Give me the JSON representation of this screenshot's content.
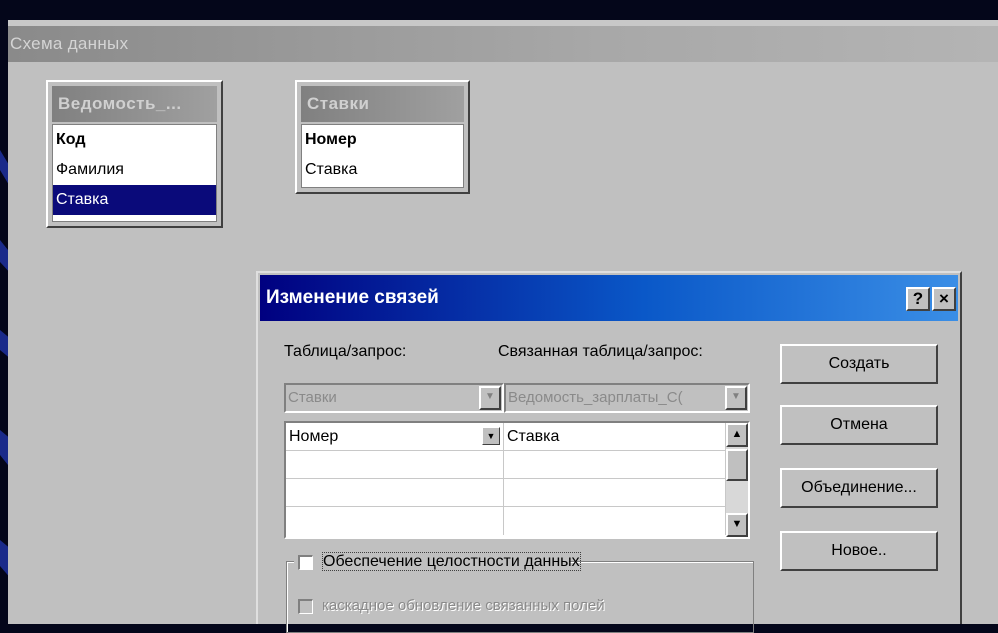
{
  "window": {
    "title": "Схема данных"
  },
  "tables": [
    {
      "title": "Ведомость_...",
      "fields": [
        {
          "name": "Код",
          "key": true
        },
        {
          "name": "Фамилия",
          "key": false
        },
        {
          "name": "Ставка",
          "key": false,
          "selected": true
        }
      ]
    },
    {
      "title": "Ставки",
      "fields": [
        {
          "name": "Номер",
          "key": true
        },
        {
          "name": "Ставка",
          "key": false
        }
      ]
    }
  ],
  "dialog": {
    "title": "Изменение связей",
    "help_label": "?",
    "close_label": "×",
    "table_label": "Таблица/запрос:",
    "related_label": "Связанная таблица/запрос:",
    "table_value": "Ставки",
    "related_value": "Ведомость_зарплаты_С(",
    "grid_rows": [
      {
        "left": "Номер",
        "right": "Ставка"
      }
    ],
    "buttons": {
      "create": "Создать",
      "cancel": "Отмена",
      "join": "Объединение...",
      "new": "Новое.."
    },
    "enforce_label": "Обеспечение целостности данных",
    "enforce_checked": false,
    "cascade_update_label": "каскадное обновление связанных полей",
    "cascade_update_enabled": false
  },
  "colors": {
    "selection": "#0a0a7a",
    "dialog_title_start": "#000080",
    "dialog_title_end": "#3a8ee6",
    "window_bg": "#c0c0c0"
  }
}
